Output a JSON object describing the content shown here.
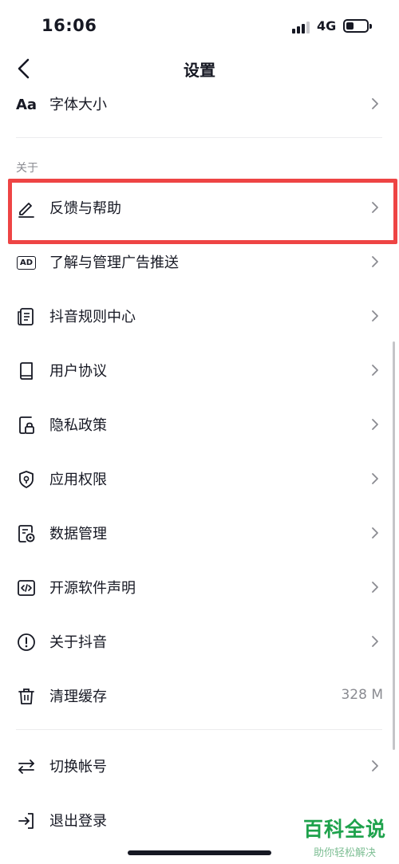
{
  "status_bar": {
    "time": "16:06",
    "network": "4G"
  },
  "header": {
    "title": "设置"
  },
  "section_about": {
    "label": "关于"
  },
  "items": [
    {
      "label": "字体大小",
      "icon": "font-size-icon"
    },
    {
      "label": "反馈与帮助",
      "icon": "edit-pen-icon"
    },
    {
      "label": "了解与管理广告推送",
      "icon": "ad-icon"
    },
    {
      "label": "抖音规则中心",
      "icon": "document-list-icon"
    },
    {
      "label": "用户协议",
      "icon": "book-icon"
    },
    {
      "label": "隐私政策",
      "icon": "privacy-lock-icon"
    },
    {
      "label": "应用权限",
      "icon": "shield-icon"
    },
    {
      "label": "数据管理",
      "icon": "data-settings-icon"
    },
    {
      "label": "开源软件声明",
      "icon": "code-icon"
    },
    {
      "label": "关于抖音",
      "icon": "info-icon"
    },
    {
      "label": "清理缓存",
      "icon": "trash-icon",
      "value": "328 M"
    },
    {
      "label": "切换帐号",
      "icon": "switch-arrows-icon"
    },
    {
      "label": "退出登录",
      "icon": "logout-icon"
    }
  ],
  "font_icon_text": "Aa",
  "ad_icon_text": "AD",
  "watermark": {
    "title": "百科全说",
    "subtitle": "助你轻松解决"
  },
  "colors": {
    "highlight": "#ee4444",
    "text": "#161823",
    "secondary": "#8a8b91",
    "watermark": "#1ea24c"
  }
}
